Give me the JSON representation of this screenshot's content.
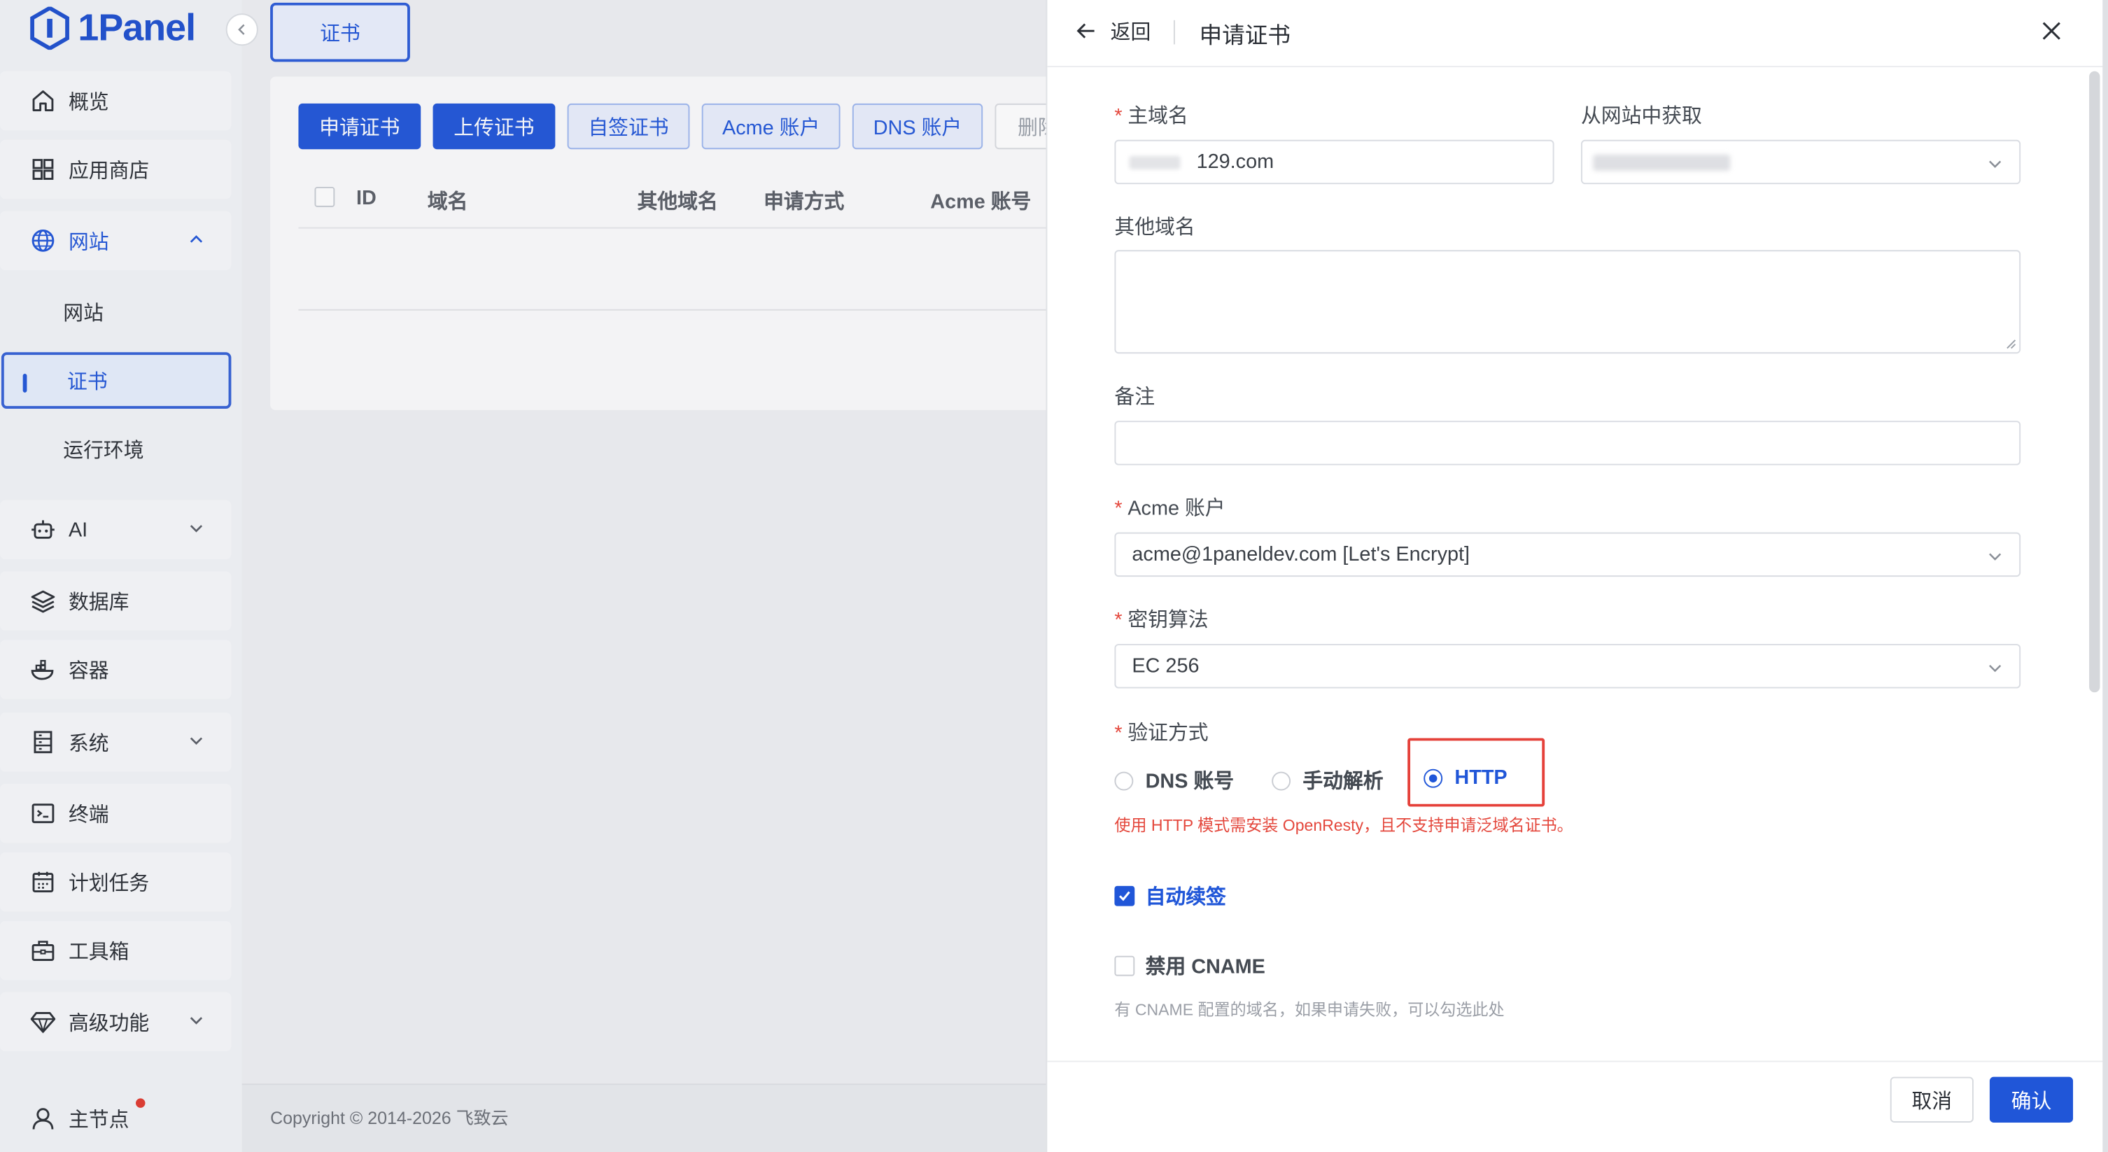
{
  "brand": {
    "name": "1Panel",
    "color": "#2056d8",
    "danger": "#e4473c"
  },
  "sidebar": {
    "items": [
      {
        "label": "概览",
        "icon": "home-icon"
      },
      {
        "label": "应用商店",
        "icon": "grid-icon"
      },
      {
        "label": "网站",
        "icon": "globe-icon",
        "expanded": true
      },
      {
        "label": "AI",
        "icon": "robot-icon"
      },
      {
        "label": "数据库",
        "icon": "layers-icon"
      },
      {
        "label": "容器",
        "icon": "whale-icon"
      },
      {
        "label": "系统",
        "icon": "server-icon"
      },
      {
        "label": "终端",
        "icon": "terminal-icon"
      },
      {
        "label": "计划任务",
        "icon": "calendar-icon"
      },
      {
        "label": "工具箱",
        "icon": "toolbox-icon"
      },
      {
        "label": "高级功能",
        "icon": "diamond-icon"
      }
    ],
    "sub_items": [
      {
        "label": "网站"
      },
      {
        "label": "证书",
        "active": true
      },
      {
        "label": "运行环境"
      }
    ],
    "user": {
      "label": "主节点"
    }
  },
  "tabs": {
    "cert": "证书"
  },
  "toolbar": {
    "apply": "申请证书",
    "upload": "上传证书",
    "self_signed": "自签证书",
    "acme": "Acme 账户",
    "dns": "DNS 账户",
    "delete": "删除"
  },
  "table": {
    "headers": [
      "ID",
      "域名",
      "其他域名",
      "申请方式",
      "Acme 账号"
    ]
  },
  "footer": {
    "copyright": "Copyright © 2014-2026 飞致云"
  },
  "drawer": {
    "back": "返回",
    "title": "申请证书",
    "fields": {
      "primary_domain": {
        "label": "主域名",
        "value": "129.com"
      },
      "from_website": {
        "label": "从网站中获取"
      },
      "other_domains": {
        "label": "其他域名",
        "value": ""
      },
      "remark": {
        "label": "备注",
        "value": ""
      },
      "acme_account": {
        "label": "Acme 账户",
        "value": "acme@1paneldev.com [Let's Encrypt]"
      },
      "key_algorithm": {
        "label": "密钥算法",
        "value": "EC 256"
      },
      "verify_method": {
        "label": "验证方式",
        "options": [
          "DNS 账号",
          "手动解析",
          "HTTP"
        ],
        "selected": "HTTP",
        "warning": "使用 HTTP 模式需安装 OpenResty，且不支持申请泛域名证书。"
      }
    },
    "auto_renew": {
      "label": "自动续签",
      "checked": true
    },
    "disable_cname": {
      "label": "禁用 CNAME",
      "checked": false,
      "hint": "有 CNAME 配置的域名，如果申请失败，可以勾选此处"
    },
    "cancel": "取消",
    "confirm": "确认"
  }
}
